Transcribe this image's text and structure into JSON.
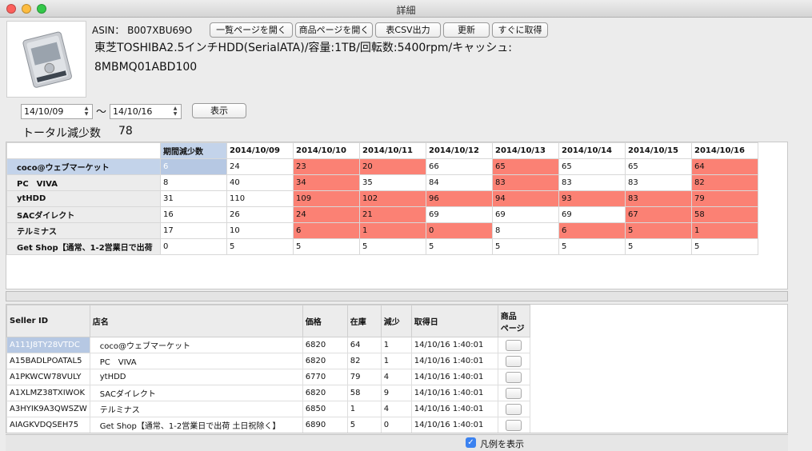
{
  "window": {
    "title": "詳細"
  },
  "header": {
    "asin_label": "ASIN： B007XBU69O",
    "buttons": {
      "list_page": "一覧ページを開く",
      "product_page": "商品ページを開く",
      "csv": "表CSV出力",
      "refresh": "更新",
      "fetch": "すぐに取得"
    },
    "product_title_line1": "東芝TOSHIBA2.5インチHDD(SerialATA)/容量:1TB/回転数:5400rpm/キャッシュ:",
    "product_title_line2": "8MBMQ01ABD100"
  },
  "filter": {
    "date_from": "14/10/09",
    "range_separator": "〜",
    "date_to": "14/10/16",
    "show_button": "表示"
  },
  "summary": {
    "total_label": "トータル減少数",
    "total_value": "78"
  },
  "grid": {
    "headers": [
      "期間減少数",
      "2014/10/09",
      "2014/10/10",
      "2014/10/11",
      "2014/10/12",
      "2014/10/13",
      "2014/10/14",
      "2014/10/15",
      "2014/10/16"
    ],
    "highlight_color": "#fb8174",
    "rows": [
      {
        "name": "coco@ウェブマーケット",
        "cells": [
          "6",
          "24",
          "23",
          "20",
          "66",
          "65",
          "65",
          "65",
          "64"
        ],
        "highlight": [
          false,
          false,
          true,
          true,
          false,
          true,
          false,
          false,
          true
        ]
      },
      {
        "name": "PC　VIVA",
        "cells": [
          "8",
          "40",
          "34",
          "35",
          "84",
          "83",
          "83",
          "83",
          "82"
        ],
        "highlight": [
          false,
          false,
          true,
          false,
          false,
          true,
          false,
          false,
          true
        ]
      },
      {
        "name": "ytHDD",
        "cells": [
          "31",
          "110",
          "109",
          "102",
          "96",
          "94",
          "93",
          "83",
          "79"
        ],
        "highlight": [
          false,
          false,
          true,
          true,
          true,
          true,
          true,
          true,
          true
        ]
      },
      {
        "name": "SACダイレクト",
        "cells": [
          "16",
          "26",
          "24",
          "21",
          "69",
          "69",
          "69",
          "67",
          "58"
        ],
        "highlight": [
          false,
          false,
          true,
          true,
          false,
          false,
          false,
          true,
          true
        ]
      },
      {
        "name": "テルミナス",
        "cells": [
          "17",
          "10",
          "6",
          "1",
          "0",
          "8",
          "6",
          "5",
          "1"
        ],
        "highlight": [
          false,
          false,
          true,
          true,
          true,
          false,
          true,
          true,
          true
        ]
      },
      {
        "name": "Get Shop【通常、1-2営業日で出荷",
        "cells": [
          "0",
          "5",
          "5",
          "5",
          "5",
          "5",
          "5",
          "5",
          "5"
        ],
        "highlight": [
          false,
          false,
          false,
          false,
          false,
          false,
          false,
          false,
          false
        ]
      }
    ]
  },
  "sellers": {
    "headers": {
      "seller_id": "Seller ID",
      "shop": "店名",
      "price": "価格",
      "stock": "在庫",
      "decrease": "減少",
      "fetched": "取得日",
      "page_line1": "商品",
      "page_line2": "ページ"
    },
    "rows": [
      {
        "seller_id": "A111J8TY28VTDC",
        "shop": "coco@ウェブマーケット",
        "price": "6820",
        "stock": "64",
        "decrease": "1",
        "fetched": "14/10/16 1:40:01"
      },
      {
        "seller_id": "A15BADLPOATAL5",
        "shop": "PC　VIVA",
        "price": "6820",
        "stock": "82",
        "decrease": "1",
        "fetched": "14/10/16 1:40:01"
      },
      {
        "seller_id": "A1PKWCW78VULY",
        "shop": "ytHDD",
        "price": "6770",
        "stock": "79",
        "decrease": "4",
        "fetched": "14/10/16 1:40:01"
      },
      {
        "seller_id": "A1XLMZ38TXIWOK",
        "shop": "SACダイレクト",
        "price": "6820",
        "stock": "58",
        "decrease": "9",
        "fetched": "14/10/16 1:40:01"
      },
      {
        "seller_id": "A3HYIK9A3QWSZW",
        "shop": "テルミナス",
        "price": "6850",
        "stock": "1",
        "decrease": "4",
        "fetched": "14/10/16 1:40:01"
      },
      {
        "seller_id": "AIAGKVDQSEH75",
        "shop": "Get Shop【通常、1-2営業日で出荷 土日祝除く】",
        "price": "6890",
        "stock": "5",
        "decrease": "0",
        "fetched": "14/10/16 1:40:01"
      }
    ]
  },
  "footer": {
    "legend_label": "凡例を表示",
    "legend_checked": true
  }
}
